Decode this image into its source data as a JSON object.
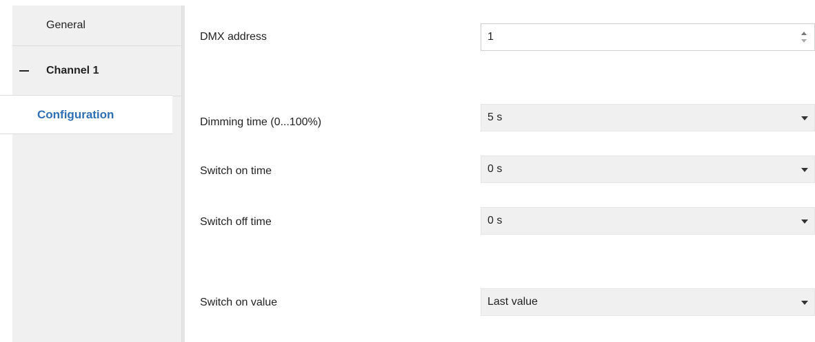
{
  "sidebar": {
    "general_label": "General",
    "channel_label": "Channel 1",
    "config_label": "Configuration"
  },
  "form": {
    "dmx_address": {
      "label": "DMX address",
      "value": "1"
    },
    "dimming_time": {
      "label": "Dimming time (0...100%)",
      "value": "5 s"
    },
    "switch_on_time": {
      "label": "Switch on time",
      "value": "0 s"
    },
    "switch_off_time": {
      "label": "Switch off time",
      "value": "0 s"
    },
    "switch_on_value": {
      "label": "Switch on value",
      "value": "Last value"
    }
  },
  "colors": {
    "accent": "#2f6fb4",
    "sidebar_bg": "#f0f0f0",
    "select_bg": "#f0f0f0"
  }
}
